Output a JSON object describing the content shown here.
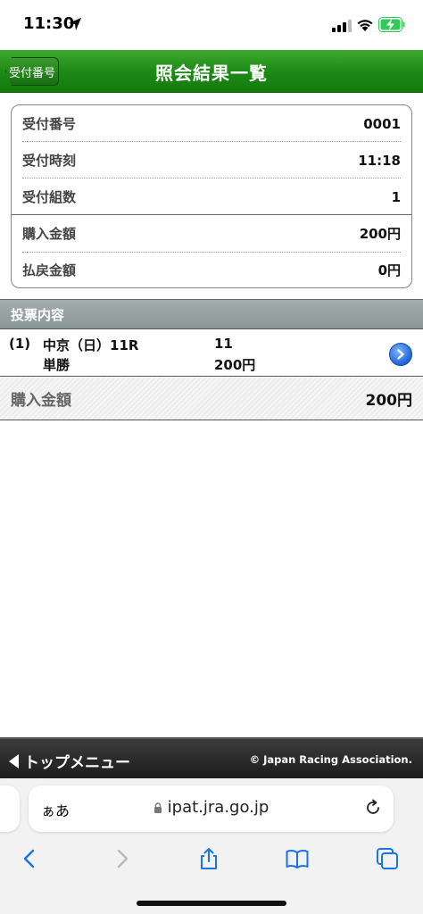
{
  "status_bar": {
    "time": "11:30"
  },
  "header": {
    "back_label": "受付番号",
    "title": "照会結果一覧"
  },
  "summary": {
    "rows": [
      {
        "label": "受付番号",
        "value": "0001"
      },
      {
        "label": "受付時刻",
        "value": "11:18"
      },
      {
        "label": "受付組数",
        "value": "1"
      },
      {
        "label": "購入金額",
        "value": "200円"
      },
      {
        "label": "払戻金額",
        "value": "0円"
      }
    ]
  },
  "section": {
    "title": "投票内容"
  },
  "bet": {
    "number": "(1)",
    "race": "中京（日）11R",
    "type": "単勝",
    "horse": "11",
    "amount": "200円"
  },
  "total": {
    "label": "購入金額",
    "value": "200円"
  },
  "footer": {
    "top_menu": "トップメニュー",
    "copyright": "© Japan Racing Association."
  },
  "browser": {
    "aa": "ぁあ",
    "url": "ipat.jra.go.jp"
  },
  "colors": {
    "header_green": "#1e8a16",
    "section_gray": "#8a9595",
    "accent_blue": "#1f62d8"
  }
}
